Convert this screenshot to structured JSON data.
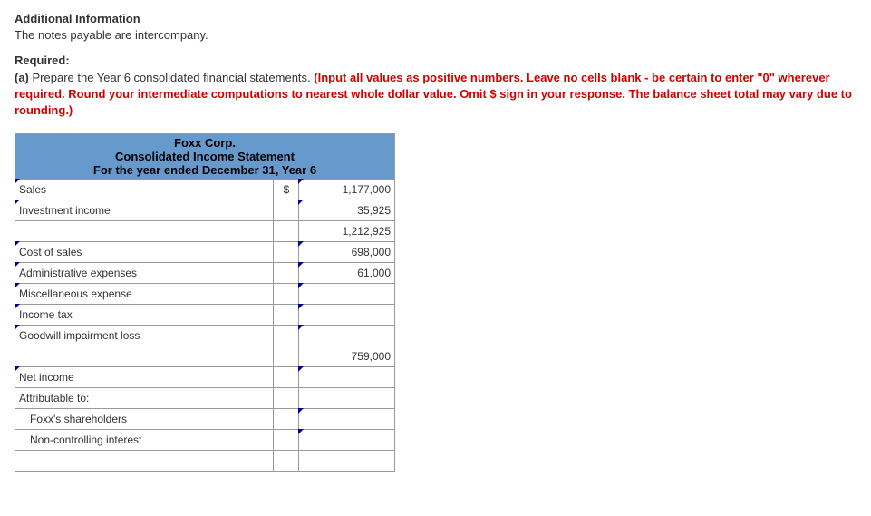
{
  "header": {
    "addl_title": "Additional Information",
    "addl_text": "The notes payable are intercompany.",
    "required_label": "Required:",
    "item_label": "(a)",
    "item_text": " Prepare the Year 6 consolidated financial statements. ",
    "red_instructions": "(Input all values as positive numbers. Leave no cells blank - be certain to enter \"0\" wherever required. Round your intermediate computations to nearest whole dollar value. Omit $ sign in your response. The balance sheet total may vary due to rounding.)"
  },
  "statement": {
    "company": "Foxx Corp.",
    "title": "Consolidated Income Statement",
    "period": "For the year ended December 31, Year 6",
    "dollar_sign": "$",
    "rows": {
      "sales": {
        "label": "Sales",
        "value": "1,177,000"
      },
      "investment_income": {
        "label": "Investment income",
        "value": "35,925"
      },
      "subtotal1": {
        "label": "",
        "value": "1,212,925"
      },
      "cost_of_sales": {
        "label": "Cost of sales",
        "value": "698,000"
      },
      "admin_exp": {
        "label": "Administrative expenses",
        "value": "61,000"
      },
      "misc_exp": {
        "label": "Miscellaneous expense",
        "value": ""
      },
      "income_tax": {
        "label": "Income tax",
        "value": ""
      },
      "goodwill": {
        "label": "Goodwill impairment loss",
        "value": ""
      },
      "subtotal2": {
        "label": "",
        "value": "759,000"
      },
      "net_income": {
        "label": "Net income",
        "value": ""
      },
      "attributable": {
        "label": "Attributable to:",
        "value": ""
      },
      "foxx_share": {
        "label": "Foxx's shareholders",
        "value": ""
      },
      "nci": {
        "label": "Non-controlling interest",
        "value": ""
      },
      "blank_end": {
        "label": "",
        "value": ""
      }
    }
  }
}
